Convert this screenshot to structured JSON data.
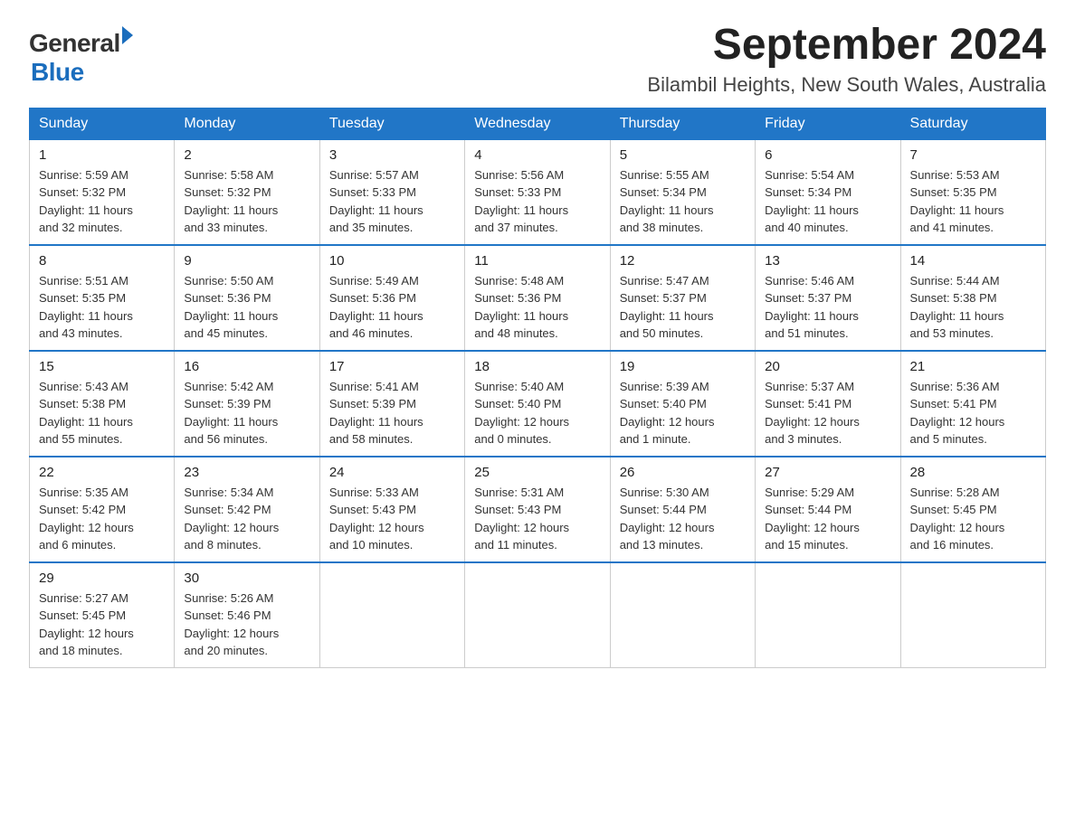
{
  "logo": {
    "text_general": "General",
    "text_blue": "Blue"
  },
  "header": {
    "month_year": "September 2024",
    "location": "Bilambil Heights, New South Wales, Australia"
  },
  "days_of_week": [
    "Sunday",
    "Monday",
    "Tuesday",
    "Wednesday",
    "Thursday",
    "Friday",
    "Saturday"
  ],
  "weeks": [
    [
      {
        "day": "1",
        "info": "Sunrise: 5:59 AM\nSunset: 5:32 PM\nDaylight: 11 hours\nand 32 minutes."
      },
      {
        "day": "2",
        "info": "Sunrise: 5:58 AM\nSunset: 5:32 PM\nDaylight: 11 hours\nand 33 minutes."
      },
      {
        "day": "3",
        "info": "Sunrise: 5:57 AM\nSunset: 5:33 PM\nDaylight: 11 hours\nand 35 minutes."
      },
      {
        "day": "4",
        "info": "Sunrise: 5:56 AM\nSunset: 5:33 PM\nDaylight: 11 hours\nand 37 minutes."
      },
      {
        "day": "5",
        "info": "Sunrise: 5:55 AM\nSunset: 5:34 PM\nDaylight: 11 hours\nand 38 minutes."
      },
      {
        "day": "6",
        "info": "Sunrise: 5:54 AM\nSunset: 5:34 PM\nDaylight: 11 hours\nand 40 minutes."
      },
      {
        "day": "7",
        "info": "Sunrise: 5:53 AM\nSunset: 5:35 PM\nDaylight: 11 hours\nand 41 minutes."
      }
    ],
    [
      {
        "day": "8",
        "info": "Sunrise: 5:51 AM\nSunset: 5:35 PM\nDaylight: 11 hours\nand 43 minutes."
      },
      {
        "day": "9",
        "info": "Sunrise: 5:50 AM\nSunset: 5:36 PM\nDaylight: 11 hours\nand 45 minutes."
      },
      {
        "day": "10",
        "info": "Sunrise: 5:49 AM\nSunset: 5:36 PM\nDaylight: 11 hours\nand 46 minutes."
      },
      {
        "day": "11",
        "info": "Sunrise: 5:48 AM\nSunset: 5:36 PM\nDaylight: 11 hours\nand 48 minutes."
      },
      {
        "day": "12",
        "info": "Sunrise: 5:47 AM\nSunset: 5:37 PM\nDaylight: 11 hours\nand 50 minutes."
      },
      {
        "day": "13",
        "info": "Sunrise: 5:46 AM\nSunset: 5:37 PM\nDaylight: 11 hours\nand 51 minutes."
      },
      {
        "day": "14",
        "info": "Sunrise: 5:44 AM\nSunset: 5:38 PM\nDaylight: 11 hours\nand 53 minutes."
      }
    ],
    [
      {
        "day": "15",
        "info": "Sunrise: 5:43 AM\nSunset: 5:38 PM\nDaylight: 11 hours\nand 55 minutes."
      },
      {
        "day": "16",
        "info": "Sunrise: 5:42 AM\nSunset: 5:39 PM\nDaylight: 11 hours\nand 56 minutes."
      },
      {
        "day": "17",
        "info": "Sunrise: 5:41 AM\nSunset: 5:39 PM\nDaylight: 11 hours\nand 58 minutes."
      },
      {
        "day": "18",
        "info": "Sunrise: 5:40 AM\nSunset: 5:40 PM\nDaylight: 12 hours\nand 0 minutes."
      },
      {
        "day": "19",
        "info": "Sunrise: 5:39 AM\nSunset: 5:40 PM\nDaylight: 12 hours\nand 1 minute."
      },
      {
        "day": "20",
        "info": "Sunrise: 5:37 AM\nSunset: 5:41 PM\nDaylight: 12 hours\nand 3 minutes."
      },
      {
        "day": "21",
        "info": "Sunrise: 5:36 AM\nSunset: 5:41 PM\nDaylight: 12 hours\nand 5 minutes."
      }
    ],
    [
      {
        "day": "22",
        "info": "Sunrise: 5:35 AM\nSunset: 5:42 PM\nDaylight: 12 hours\nand 6 minutes."
      },
      {
        "day": "23",
        "info": "Sunrise: 5:34 AM\nSunset: 5:42 PM\nDaylight: 12 hours\nand 8 minutes."
      },
      {
        "day": "24",
        "info": "Sunrise: 5:33 AM\nSunset: 5:43 PM\nDaylight: 12 hours\nand 10 minutes."
      },
      {
        "day": "25",
        "info": "Sunrise: 5:31 AM\nSunset: 5:43 PM\nDaylight: 12 hours\nand 11 minutes."
      },
      {
        "day": "26",
        "info": "Sunrise: 5:30 AM\nSunset: 5:44 PM\nDaylight: 12 hours\nand 13 minutes."
      },
      {
        "day": "27",
        "info": "Sunrise: 5:29 AM\nSunset: 5:44 PM\nDaylight: 12 hours\nand 15 minutes."
      },
      {
        "day": "28",
        "info": "Sunrise: 5:28 AM\nSunset: 5:45 PM\nDaylight: 12 hours\nand 16 minutes."
      }
    ],
    [
      {
        "day": "29",
        "info": "Sunrise: 5:27 AM\nSunset: 5:45 PM\nDaylight: 12 hours\nand 18 minutes."
      },
      {
        "day": "30",
        "info": "Sunrise: 5:26 AM\nSunset: 5:46 PM\nDaylight: 12 hours\nand 20 minutes."
      },
      null,
      null,
      null,
      null,
      null
    ]
  ]
}
